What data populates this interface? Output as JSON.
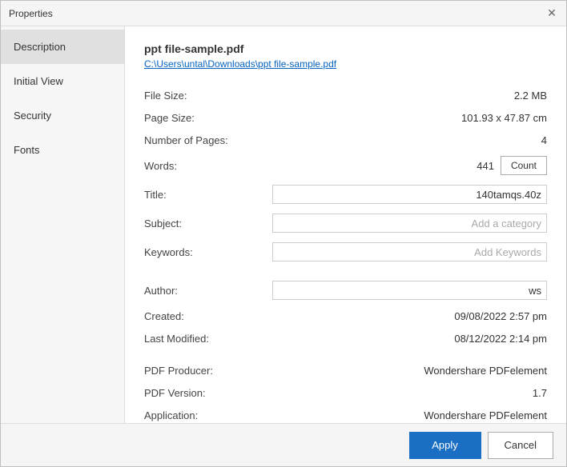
{
  "window": {
    "title": "Properties",
    "close_label": "✕"
  },
  "sidebar": {
    "items": [
      {
        "id": "description",
        "label": "Description",
        "active": true
      },
      {
        "id": "initial-view",
        "label": "Initial View",
        "active": false
      },
      {
        "id": "security",
        "label": "Security",
        "active": false
      },
      {
        "id": "fonts",
        "label": "Fonts",
        "active": false
      }
    ]
  },
  "main": {
    "file_name": "ppt file-sample.pdf",
    "file_path": "C:\\Users\\untal\\Downloads\\ppt file-sample.pdf",
    "fields": [
      {
        "label": "File Size:",
        "value": "2.2 MB",
        "type": "text"
      },
      {
        "label": "Page Size:",
        "value": "101.93 x 47.87 cm",
        "type": "text"
      },
      {
        "label": "Number of Pages:",
        "value": "4",
        "type": "text"
      },
      {
        "label": "Words:",
        "value": "441",
        "type": "words"
      },
      {
        "label": "Title:",
        "value": "140tamqs.40z",
        "type": "input"
      },
      {
        "label": "Subject:",
        "value": "",
        "placeholder": "Add a category",
        "type": "input"
      },
      {
        "label": "Keywords:",
        "value": "",
        "placeholder": "Add Keywords",
        "type": "input"
      },
      {
        "label": "Author:",
        "value": "ws",
        "type": "input"
      },
      {
        "label": "Created:",
        "value": "09/08/2022 2:57 pm",
        "type": "text"
      },
      {
        "label": "Last Modified:",
        "value": "08/12/2022 2:14 pm",
        "type": "text"
      },
      {
        "label": "PDF Producer:",
        "value": "Wondershare PDFelement",
        "type": "text"
      },
      {
        "label": "PDF Version:",
        "value": "1.7",
        "type": "text"
      },
      {
        "label": "Application:",
        "value": "Wondershare PDFelement",
        "type": "text"
      }
    ],
    "count_button_label": "Count"
  },
  "footer": {
    "apply_label": "Apply",
    "cancel_label": "Cancel"
  }
}
